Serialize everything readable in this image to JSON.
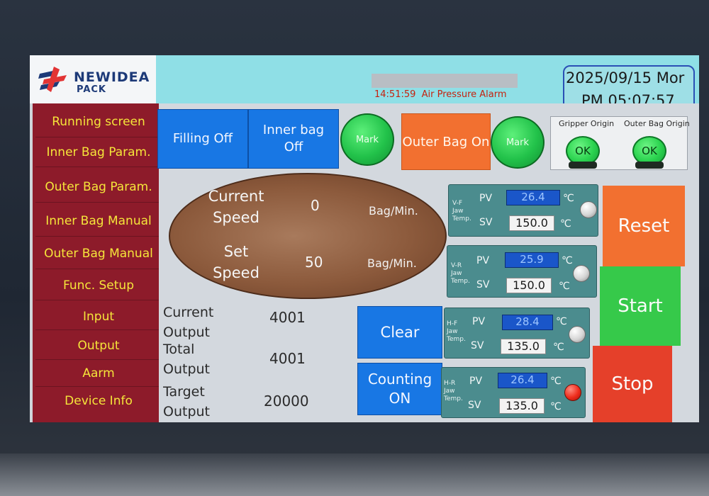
{
  "logo": {
    "line1": "NEWIDEA",
    "line2": "PACK"
  },
  "header": {
    "alarm_time": "14:51:59",
    "alarm_text": "Air Pressure Alarm",
    "date": "2025/09/15 Mor",
    "time": "PM 05:07:57"
  },
  "sidebar": {
    "items": [
      {
        "label": "Running screen"
      },
      {
        "label": "Inner Bag Param."
      },
      {
        "label": "Outer Bag Param."
      },
      {
        "label": "Inner Bag Manual"
      },
      {
        "label": "Outer Bag Manual"
      },
      {
        "label": "Func. Setup"
      },
      {
        "label": "Input"
      },
      {
        "label": "Output"
      },
      {
        "label": "Aarm"
      },
      {
        "label": "Device Info"
      }
    ]
  },
  "controls": {
    "filling": "Filling Off",
    "inner_bag_line1": "Inner bag",
    "inner_bag_line2": "Off",
    "mark1": "Mark",
    "outer_bag": "Outer Bag On",
    "mark2": "Mark"
  },
  "gripper": {
    "gripper_origin_label": "Gripper Origin",
    "gripper_origin_state": "OK",
    "outer_bag_origin_label": "Outer Bag Origin",
    "outer_bag_origin_state": "OK"
  },
  "speed": {
    "current_label_1": "Current",
    "current_label_2": "Speed",
    "current_value": "0",
    "set_label_1": "Set",
    "set_label_2": "Speed",
    "set_value": "50",
    "unit": "Bag/Min."
  },
  "output": {
    "current_label_1": "Current",
    "current_label_2": "Output",
    "current_value": "4001",
    "total_label_1": "Total",
    "total_label_2": "Output",
    "total_value": "4001",
    "target_label_1": "Target",
    "target_label_2": "Output",
    "target_value": "20000"
  },
  "actions": {
    "clear": "Clear",
    "counting_line1": "Counting",
    "counting_line2": "ON",
    "reset": "Reset",
    "start": "Start",
    "stop": "Stop"
  },
  "temps": [
    {
      "code": "V-F",
      "jaw": "Jaw",
      "temp": "Temp.",
      "pv_label": "PV",
      "pv": "26.4",
      "sv_label": "SV",
      "sv": "150.0",
      "unit": "℃",
      "heater": "off"
    },
    {
      "code": "V-R",
      "jaw": "Jaw",
      "temp": "Temp.",
      "pv_label": "PV",
      "pv": "25.9",
      "sv_label": "SV",
      "sv": "150.0",
      "unit": "℃",
      "heater": "off"
    },
    {
      "code": "H-F",
      "jaw": "Jaw",
      "temp": "Temp.",
      "pv_label": "PV",
      "pv": "28.4",
      "sv_label": "SV",
      "sv": "135.0",
      "unit": "℃",
      "heater": "off"
    },
    {
      "code": "H-R",
      "jaw": "Jaw",
      "temp": "Temp.",
      "pv_label": "PV",
      "pv": "26.4",
      "sv_label": "SV",
      "sv": "135.0",
      "unit": "℃",
      "heater": "on"
    }
  ],
  "colors": {
    "sidebar_bg": "#8d1b2a",
    "sidebar_text": "#f5e53a",
    "header_bg": "#8fdfe6",
    "blue_button": "#1877e4",
    "orange_button": "#f27030",
    "green_lamp": "#22c24a",
    "reset": "#f27030",
    "start": "#36c94a",
    "stop": "#e5402a",
    "alarm_text": "#c6220f"
  }
}
